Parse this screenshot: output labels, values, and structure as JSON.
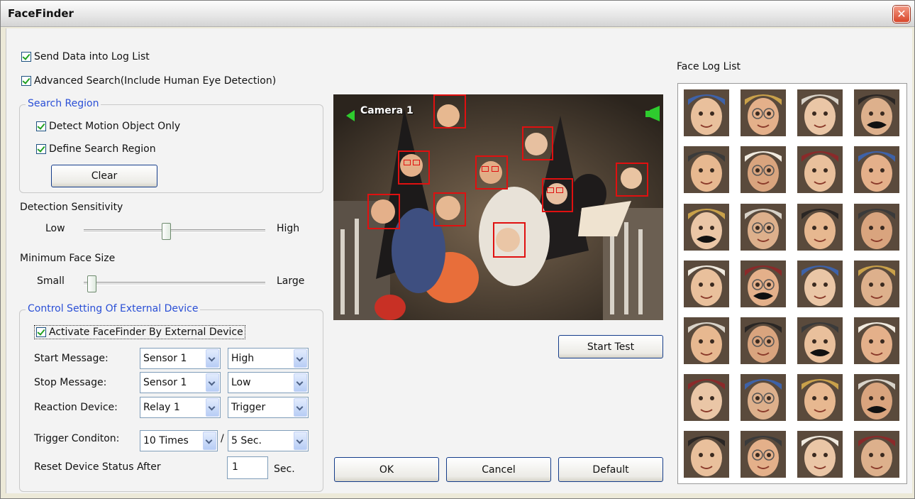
{
  "window": {
    "title": "FaceFinder",
    "close_icon": "close-icon"
  },
  "options": {
    "send_data": {
      "label": "Send Data into Log List",
      "checked": true
    },
    "advanced_search": {
      "label": "Advanced Search(Include Human Eye Detection)",
      "checked": true
    }
  },
  "search_region": {
    "title": "Search Region",
    "detect_motion": {
      "label": "Detect Motion Object Only",
      "checked": true
    },
    "define_region": {
      "label": "Define Search Region",
      "checked": true
    },
    "clear_label": "Clear"
  },
  "sensitivity": {
    "title": "Detection Sensitivity",
    "low": "Low",
    "high": "High",
    "level": 0.45
  },
  "face_size": {
    "title": "Minimum Face Size",
    "small": "Small",
    "large": "Large",
    "level": 0.02
  },
  "external": {
    "title": "Control Setting Of External Device",
    "activate": {
      "label": "Activate FaceFinder By External Device",
      "checked": true
    },
    "start_label": "Start Message:",
    "start_sensor": "Sensor 1",
    "start_level": "High",
    "stop_label": "Stop Message:",
    "stop_sensor": "Sensor 1",
    "stop_level": "Low",
    "reaction_label": "Reaction Device:",
    "reaction_device": "Relay 1",
    "reaction_mode": "Trigger",
    "trigger_label": "Trigger Conditon:",
    "trigger_times": "10 Times",
    "slash": "/",
    "trigger_period": "5 Sec.",
    "reset_label": "Reset Device Status After",
    "reset_value": "1",
    "reset_unit": "Sec."
  },
  "video": {
    "camera_label": "Camera 1"
  },
  "buttons": {
    "start_test": "Start Test",
    "ok": "OK",
    "cancel": "Cancel",
    "default": "Default"
  },
  "face_log": {
    "title": "Face Log List"
  },
  "colors": {
    "accent": "#2a4fd6",
    "face_box": "#e01010",
    "button_border": "#143c8a"
  }
}
